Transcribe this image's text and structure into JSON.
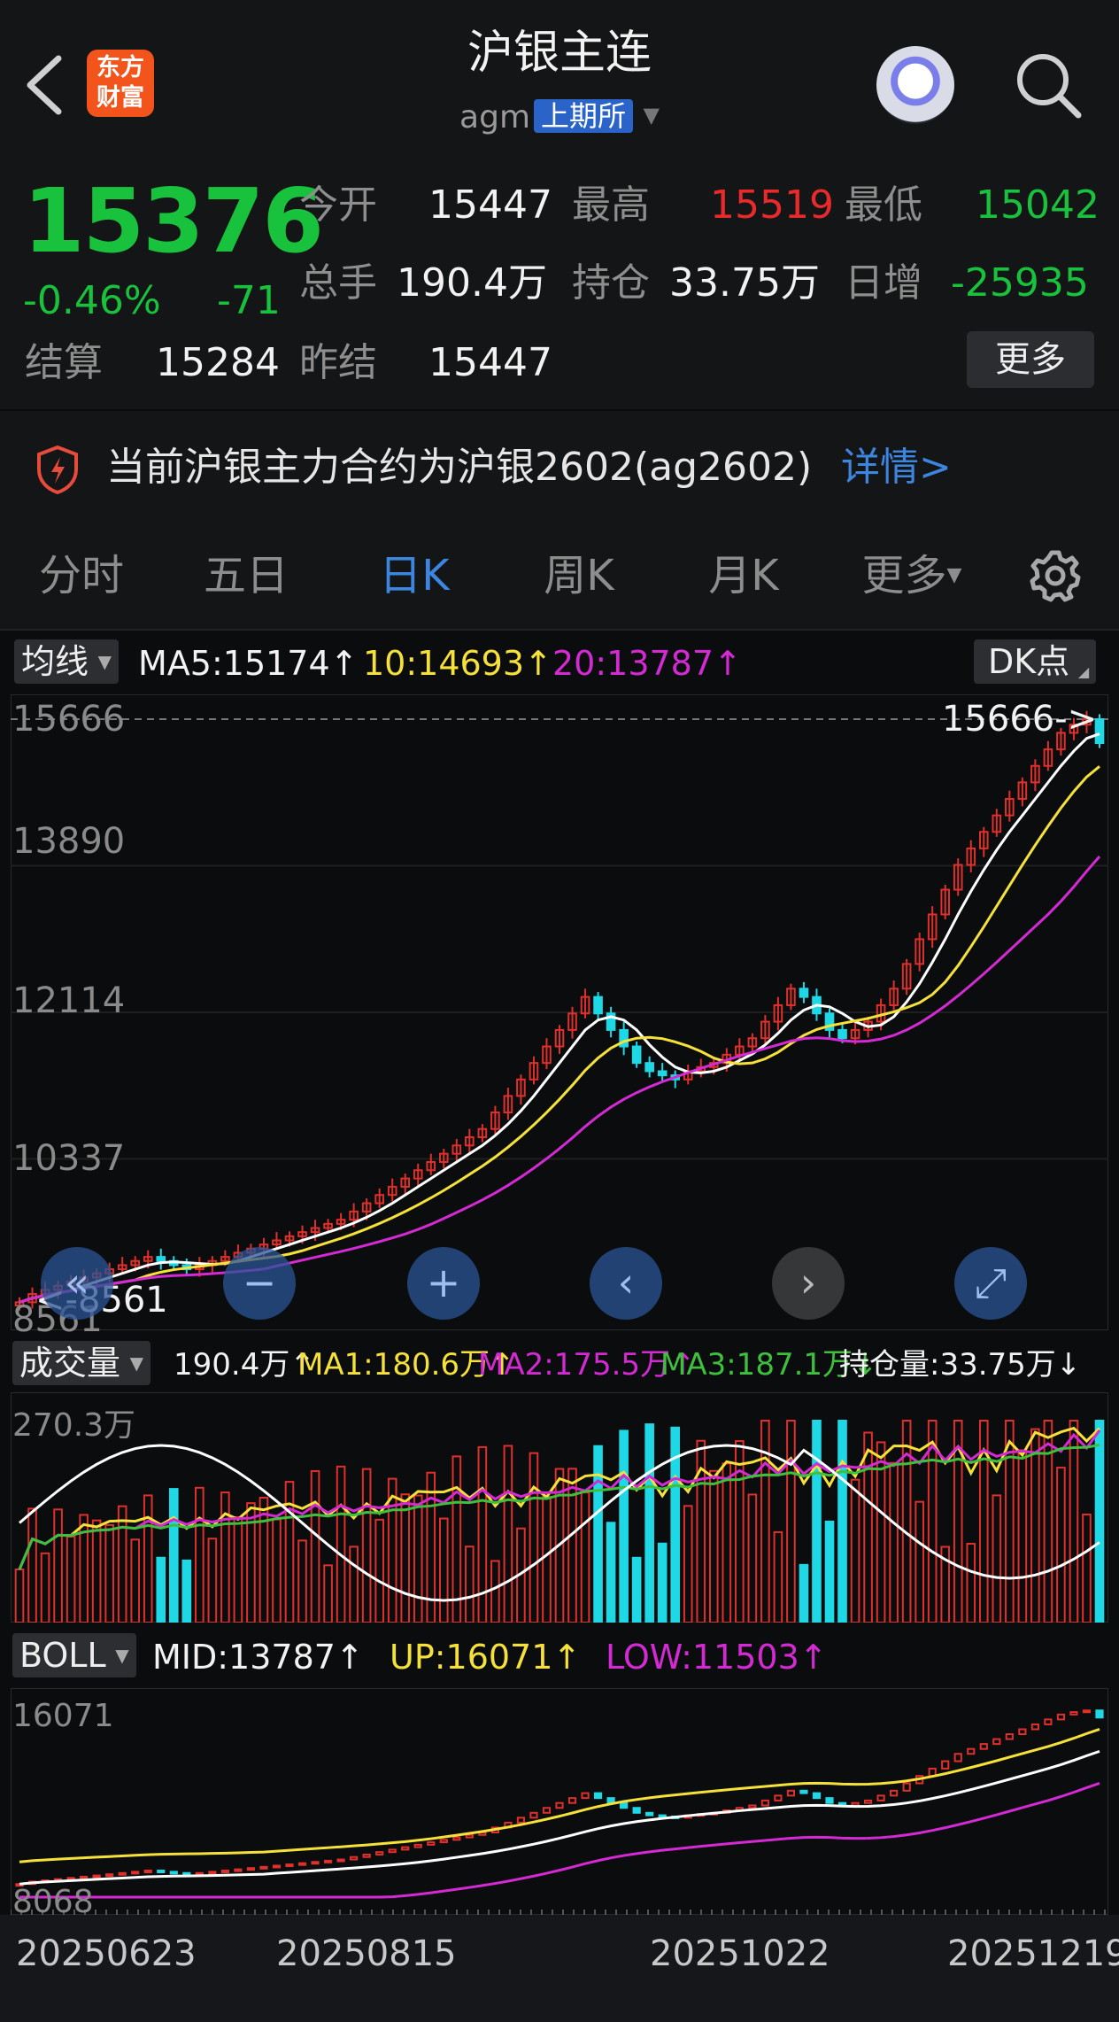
{
  "header": {
    "title": "沪银主连",
    "symbol": "agm",
    "exchange": "上期所",
    "logo_text": "东方财富",
    "back_icon": "chevron-left-icon",
    "search_icon": "search-icon"
  },
  "quote": {
    "price": "15376",
    "change_pct": "-0.46%",
    "change": "-71",
    "open_label": "今开",
    "open": "15447",
    "high_label": "最高",
    "high": "15519",
    "low_label": "最低",
    "low": "15042",
    "volume_label": "总手",
    "volume": "190.4万",
    "position_label": "持仓",
    "position": "33.75万",
    "daily_inc_label": "日增",
    "daily_inc": "-25935",
    "settle_label": "结算",
    "settle": "15284",
    "prev_settle_label": "昨结",
    "prev_settle": "15447",
    "more_button": "更多"
  },
  "notice": {
    "text": "当前沪银主力合约为沪银2602(ag2602)",
    "link": "详情>"
  },
  "tabs": [
    {
      "label": "分时"
    },
    {
      "label": "五日"
    },
    {
      "label": "日K"
    },
    {
      "label": "周K"
    },
    {
      "label": "月K"
    },
    {
      "label": "更多"
    }
  ],
  "active_tab": "日K",
  "ma_bar": {
    "selector": "均线",
    "ma5": "MA5:15174↑",
    "ma10": "10:14693↑",
    "ma20": "20:13787↑",
    "dk_button": "DK点"
  },
  "main_chart": {
    "y_labels": [
      "15666",
      "13890",
      "12114",
      "10337",
      "8561"
    ],
    "max_marker": "15666->",
    "min_marker": "<-8561"
  },
  "volume_bar": {
    "selector": "成交量",
    "vol": "190.4万↑",
    "ma1": "MA1:180.6万↑",
    "ma2": "MA2:175.5万↑",
    "ma3": "MA3:187.1万↓",
    "oi": "持仓量:33.75万↓",
    "y_label": "270.3万"
  },
  "boll_bar": {
    "selector": "BOLL",
    "mid": "MID:13787↑",
    "up": "UP:16071↑",
    "low": "LOW:11503↑",
    "y_top": "16071",
    "y_bottom": "8068"
  },
  "dates": [
    "20250623",
    "20250815",
    "20251022",
    "20251219"
  ],
  "colors": {
    "up": "#e0302b",
    "down": "#1fd8e6",
    "ma5": "#ffffff",
    "ma10": "#f5e13a",
    "ma20": "#d42ad4",
    "ma3": "#3ec03e",
    "price_down": "#19c23c"
  },
  "chart_data": {
    "type": "candlestick",
    "daily_closes_approx": [
      8600,
      8700,
      8750,
      8800,
      8850,
      8900,
      8950,
      9000,
      9050,
      9100,
      9150,
      9100,
      9050,
      9000,
      9050,
      9100,
      9150,
      9200,
      9250,
      9300,
      9350,
      9400,
      9450,
      9500,
      9550,
      9600,
      9700,
      9800,
      9900,
      10000,
      10100,
      10200,
      10300,
      10400,
      10500,
      10600,
      10700,
      10900,
      11100,
      11300,
      11500,
      11700,
      11900,
      12100,
      12300,
      12100,
      11900,
      11700,
      11500,
      11400,
      11350,
      11300,
      11400,
      11450,
      11500,
      11600,
      11700,
      11800,
      12000,
      12200,
      12400,
      12300,
      12100,
      11900,
      11800,
      11900,
      12000,
      12200,
      12400,
      12700,
      13000,
      13300,
      13600,
      13900,
      14100,
      14300,
      14500,
      14700,
      14900,
      15100,
      15300,
      15500,
      15600,
      15666,
      15376
    ]
  }
}
